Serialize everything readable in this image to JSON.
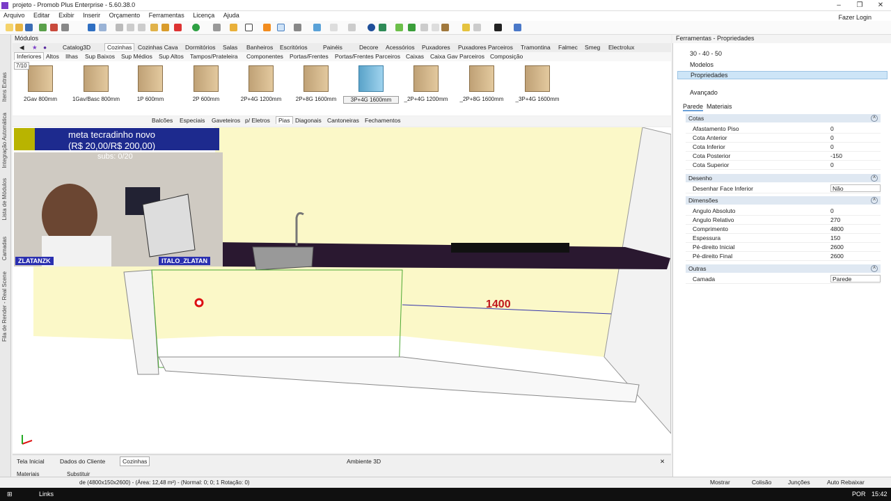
{
  "window": {
    "title": "projeto - Promob Plus Enterprise - 5.60.38.0",
    "min": "–",
    "max": "❐",
    "close": "✕"
  },
  "menu": [
    "Arquivo",
    "Editar",
    "Exibir",
    "Inserir",
    "Orçamento",
    "Ferramentas",
    "Licença",
    "Ajuda"
  ],
  "login": "Fazer Login",
  "left_tabs": [
    "Itens Extras",
    "Integração Automática",
    "Lista de Módulos",
    "Camadas",
    "Fila de Render - Real Scene"
  ],
  "modules": {
    "header": "Módulos",
    "catalog_tabs": [
      "Catalog3D",
      "Cozinhas",
      "Cozinhas Cava",
      "Dormitórios",
      "Salas",
      "Banheiros",
      "Escritórios",
      "Painéis",
      "Decore",
      "Acessórios",
      "Puxadores",
      "Puxadores Parceiros",
      "Tramontina",
      "Falmec",
      "Smeg",
      "Electrolux"
    ],
    "sub_tabs": [
      "Inferiores",
      "Altos",
      "Ilhas",
      "Sup Baixos",
      "Sup Médios",
      "Sup Altos",
      "Tampos/Prateleira",
      "Componentes",
      "Portas/Frentes",
      "Portas/Frentes Parceiros",
      "Caixas",
      "Caixa Gav Parceiros",
      "Composição"
    ],
    "counter": "7/10",
    "items": [
      "2Gav 800mm",
      "1Gav/Basc 800mm",
      "1P 600mm",
      "2P 600mm",
      "2P+4G 1200mm",
      "2P+8G 1600mm",
      "3P+4G 1600mm",
      "_2P+4G 1200mm",
      "_2P+8G 1600mm",
      "_3P+4G 1600mm"
    ],
    "selected_item": "3P+4G 1600mm",
    "pia_tabs": [
      "Balcões",
      "Especiais",
      "Gaveteiros",
      "p/ Eletros",
      "Pias",
      "Diagonais",
      "Cantoneiras",
      "Fechamentos"
    ]
  },
  "stream": {
    "meta_line1": "meta tecradinho novo",
    "meta_line2": "(R$ 20,00/R$ 200,00)",
    "subs": "subs: 0/20",
    "name1": "ZLATANZK",
    "name2": "ITALO_ZLATAN"
  },
  "viewport": {
    "dimension": "1400"
  },
  "bottom_tabs": [
    "Tela Inicial",
    "Dados do Cliente",
    "Cozinhas"
  ],
  "ambient_tab": "Ambiente 3D",
  "properties": {
    "header": "Ferramentas - Propriedades",
    "items": [
      "30 - 40 - 50",
      "Modelos",
      "Propriedades"
    ],
    "advanced": "Avançado",
    "tabs": [
      "Parede",
      "Materiais"
    ],
    "sections": [
      {
        "title": "Cotas",
        "rows": [
          [
            "Afastamento Piso",
            "0"
          ],
          [
            "Cota Anterior",
            "0"
          ],
          [
            "Cota Inferior",
            "0"
          ],
          [
            "Cota Posterior",
            "-150"
          ],
          [
            "Cota Superior",
            "0"
          ]
        ]
      },
      {
        "title": "Desenho",
        "rows": [
          [
            "Desenhar Face Inferior",
            "Não"
          ]
        ]
      },
      {
        "title": "Dimensões",
        "rows": [
          [
            "Angulo Absoluto",
            "0"
          ],
          [
            "Angulo Relativo",
            "270"
          ],
          [
            "Comprimento",
            "4800"
          ],
          [
            "Espessura",
            "150"
          ],
          [
            "Pé-direito Inicial",
            "2600"
          ],
          [
            "Pé-direito Final",
            "2600"
          ]
        ]
      },
      {
        "title": "Outras",
        "rows": [
          [
            "Camada",
            "Parede"
          ]
        ]
      }
    ]
  },
  "status": {
    "text": "de (4800x150x2600) - (Área: 12,48 m²) - (Normal: 0; 0; 1 Rotação: 0)",
    "materiais": "Materiais",
    "substituir": "Substituir",
    "mostrar": "Mostrar",
    "colisao": "Colisão",
    "juncoes": "Junções",
    "auto": "Auto Rebaixar"
  },
  "taskbar": {
    "links": "Links",
    "lang": "POR",
    "time": "15:42"
  }
}
